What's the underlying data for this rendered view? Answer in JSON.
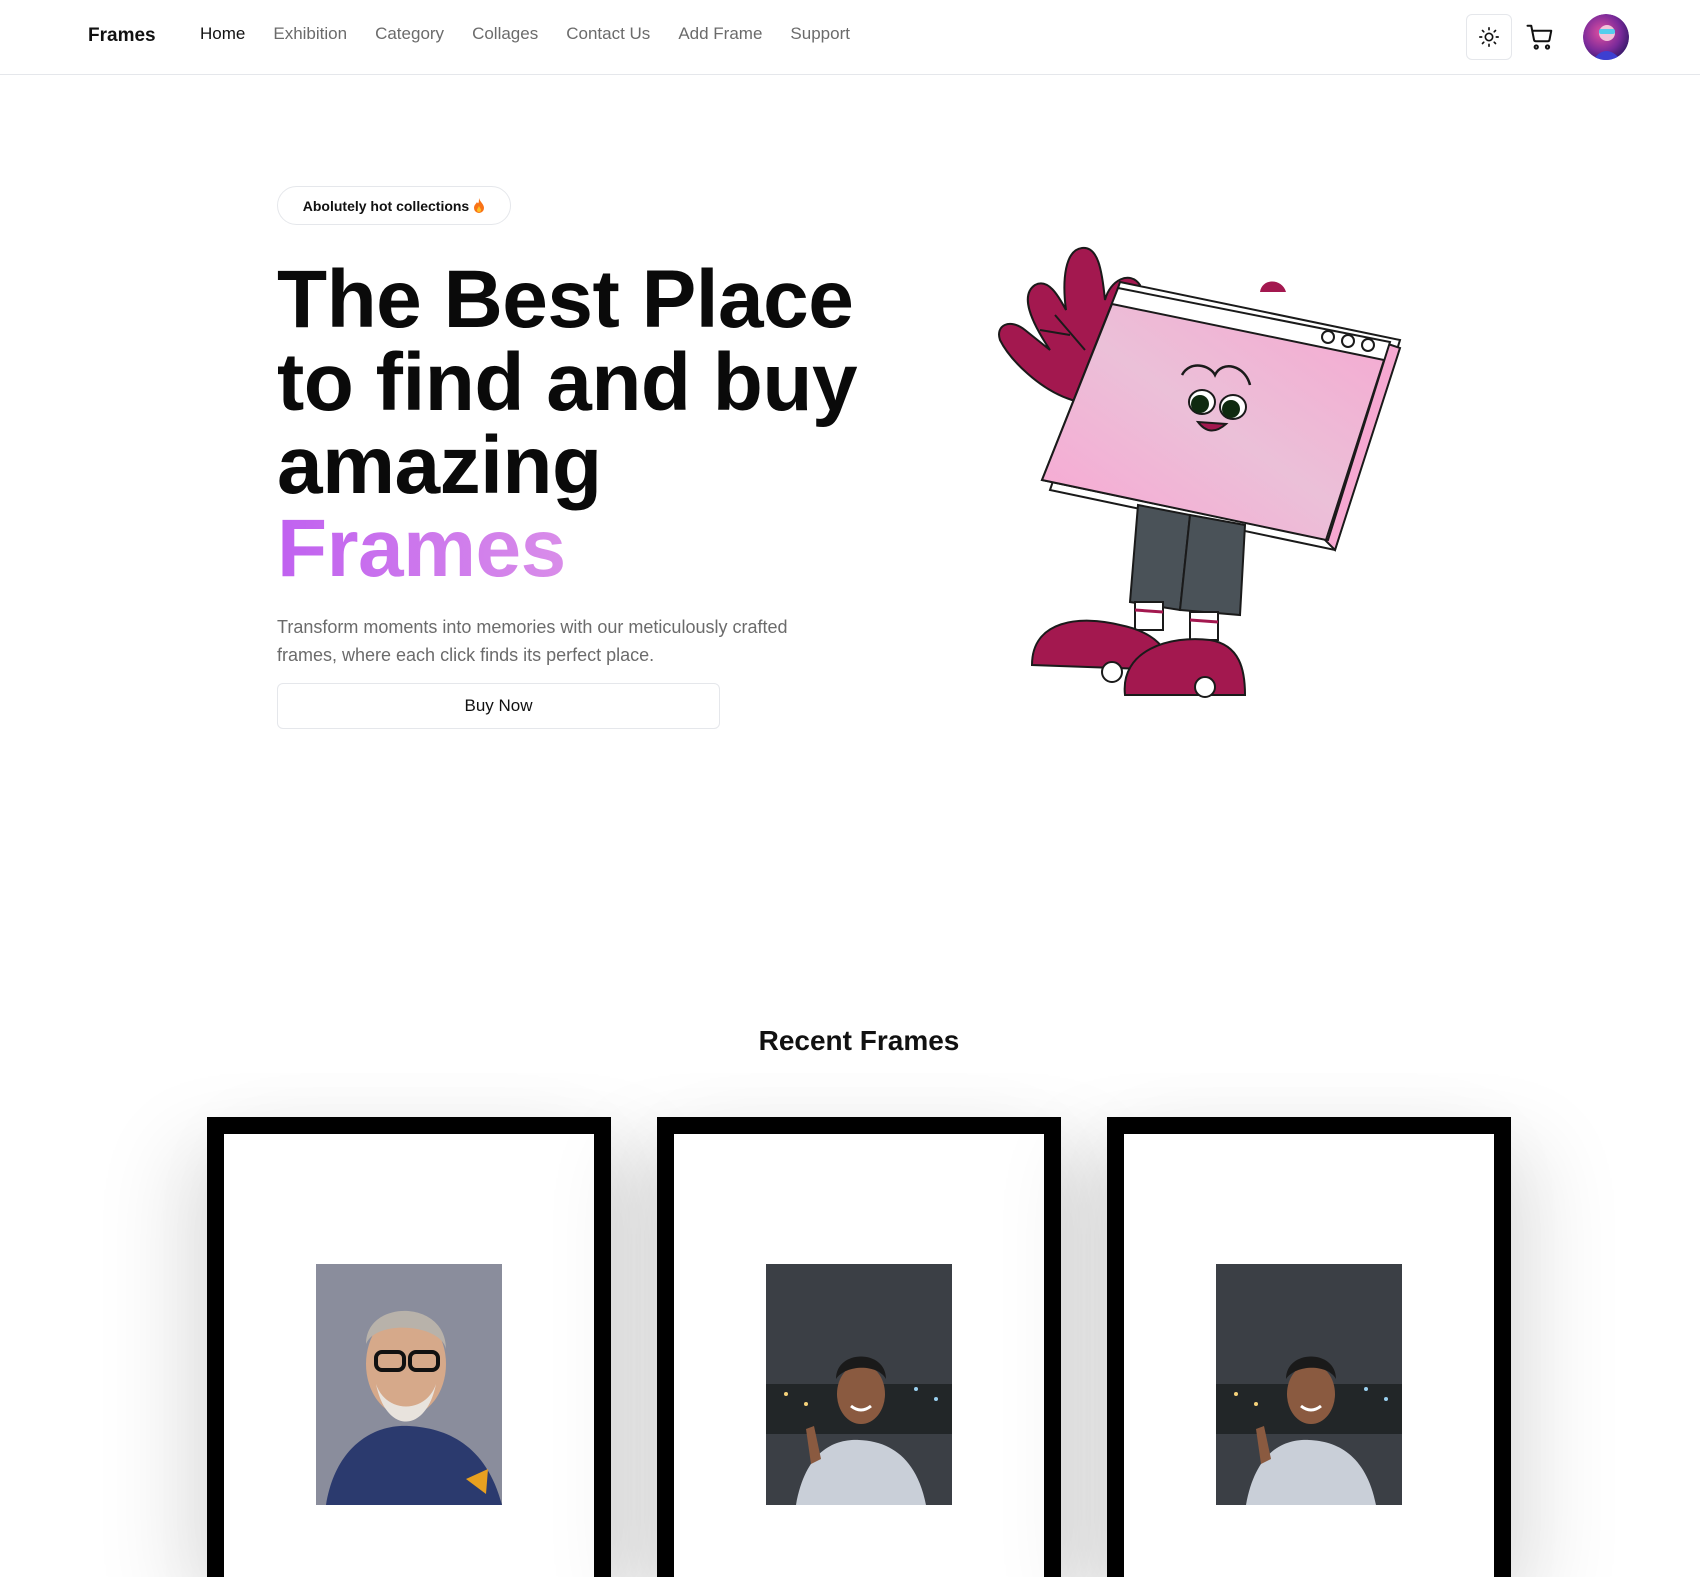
{
  "brand": "Frames",
  "nav": {
    "items": [
      {
        "label": "Home",
        "active": true
      },
      {
        "label": "Exhibition",
        "active": false
      },
      {
        "label": "Category",
        "active": false
      },
      {
        "label": "Collages",
        "active": false
      },
      {
        "label": "Contact Us",
        "active": false
      },
      {
        "label": "Add Frame",
        "active": false
      },
      {
        "label": "Support",
        "active": false
      }
    ],
    "theme_icon": "sun-icon",
    "cart_icon": "cart-icon",
    "avatar_icon": "user-avatar"
  },
  "hero": {
    "badge": "Abolutely hot collections",
    "badge_icon": "flame-icon",
    "title_line1": "The Best Place",
    "title_line2": "to find and buy",
    "title_line3": "amazing",
    "title_highlight": "Frames",
    "description": "Transform moments into memories with our meticulously crafted frames, where each click finds its perfect place.",
    "cta": "Buy Now"
  },
  "recent": {
    "title": "Recent Frames",
    "frames": [
      {
        "photo": "portrait-elder-man"
      },
      {
        "photo": "portrait-young-man-night"
      },
      {
        "photo": "portrait-young-man-night"
      }
    ]
  },
  "colors": {
    "accent_start": "#c061f0",
    "accent_end": "#f6b3e6",
    "mascot_magenta": "#a3184f",
    "mascot_pink": "#f4a9d4",
    "text_muted": "#6b6b6b"
  }
}
